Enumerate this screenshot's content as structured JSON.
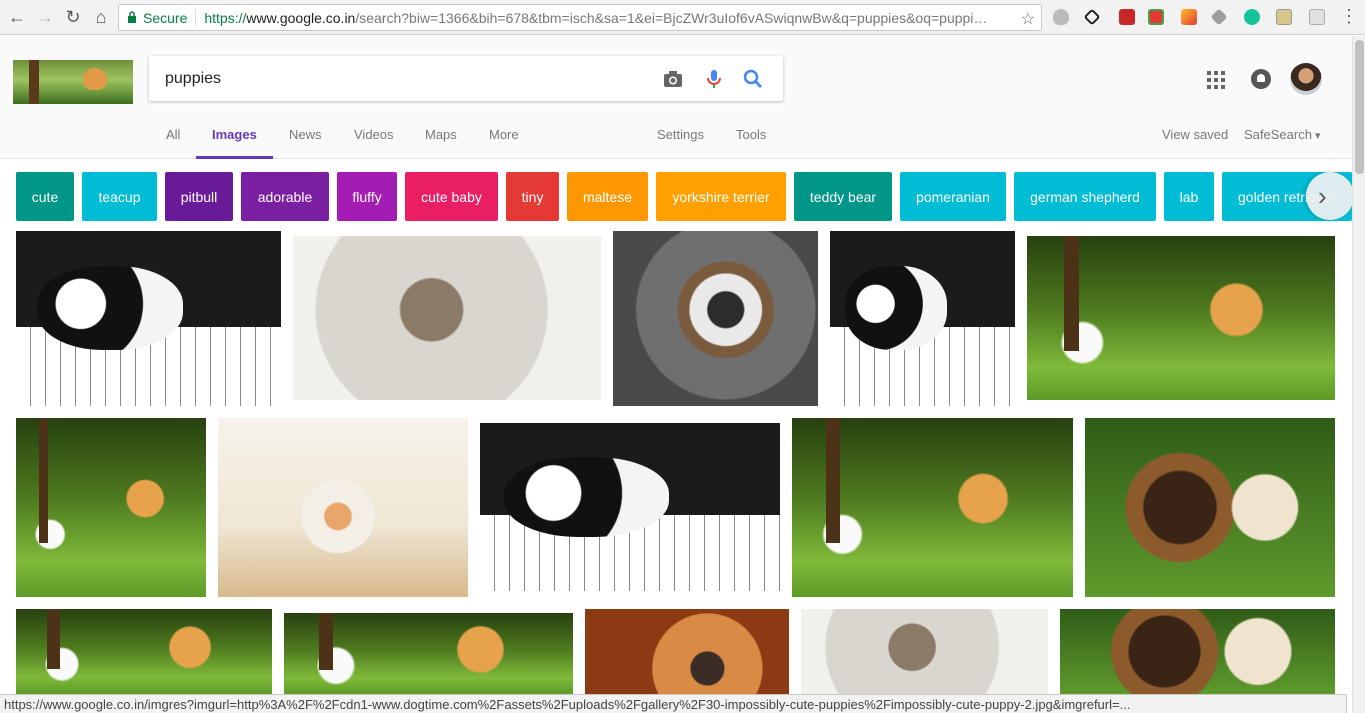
{
  "browser": {
    "secure_label": "Secure",
    "url_proto": "https://",
    "url_host": "www.google.co.in",
    "url_rest": "/search?biw=1366&bih=678&tbm=isch&sa=1&ei=BjcZWr3uIof6vASwiqnwBw&q=puppies&oq=puppi…"
  },
  "search": {
    "query": "puppies"
  },
  "tabs": {
    "all": "All",
    "images": "Images",
    "news": "News",
    "videos": "Videos",
    "maps": "Maps",
    "more": "More",
    "settings": "Settings",
    "tools": "Tools",
    "view_saved": "View saved",
    "safesearch": "SafeSearch"
  },
  "chips": [
    {
      "label": "cute",
      "color": "#009688"
    },
    {
      "label": "teacup",
      "color": "#00bcd4"
    },
    {
      "label": "pitbull",
      "color": "#6a1b9a"
    },
    {
      "label": "adorable",
      "color": "#7b1fa2"
    },
    {
      "label": "fluffy",
      "color": "#a51cb5"
    },
    {
      "label": "cute baby",
      "color": "#e91e63"
    },
    {
      "label": "tiny",
      "color": "#e53935"
    },
    {
      "label": "maltese",
      "color": "#ff9800"
    },
    {
      "label": "yorkshire terrier",
      "color": "#ffa000"
    },
    {
      "label": "teddy bear",
      "color": "#009688"
    },
    {
      "label": "pomeranian",
      "color": "#00bcd4"
    },
    {
      "label": "german shepherd",
      "color": "#00bcd4"
    },
    {
      "label": "lab",
      "color": "#00bcd4"
    },
    {
      "label": "golden retriever",
      "color": "#00bcd4"
    }
  ],
  "status_url": "https://www.google.co.in/imgres?imgurl=http%3A%2F%2Fcdn1-www.dogtime.com%2Fassets%2Fuploads%2Fgallery%2F30-impossibly-cute-puppies%2Fimpossibly-cute-puppy-2.jpg&imgrefurl=..."
}
